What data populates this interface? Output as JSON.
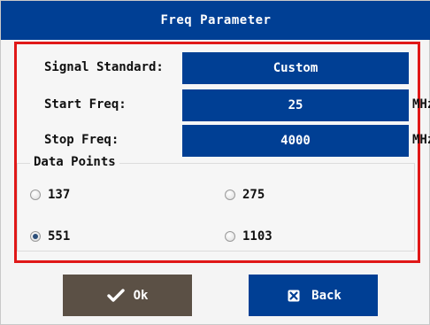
{
  "dialog": {
    "title": "Freq Parameter"
  },
  "fields": {
    "signal_standard": {
      "label": "Signal Standard:",
      "value": "Custom"
    },
    "start_freq": {
      "label": "Start Freq:",
      "value": "25",
      "unit": "MHz"
    },
    "stop_freq": {
      "label": "Stop Freq:",
      "value": "4000",
      "unit": "MHz"
    }
  },
  "data_points": {
    "title": "Data Points",
    "options": [
      "137",
      "275",
      "551",
      "1103"
    ],
    "selected": "551"
  },
  "buttons": {
    "ok_label": "Ok",
    "back_label": "Back"
  },
  "colors": {
    "title_bar": "#003f94",
    "highlight_border": "#e01818",
    "ok_button": "#5b5045",
    "value_box": "#003f94"
  },
  "icons": {
    "ok": "check-icon",
    "back": "close-icon"
  }
}
